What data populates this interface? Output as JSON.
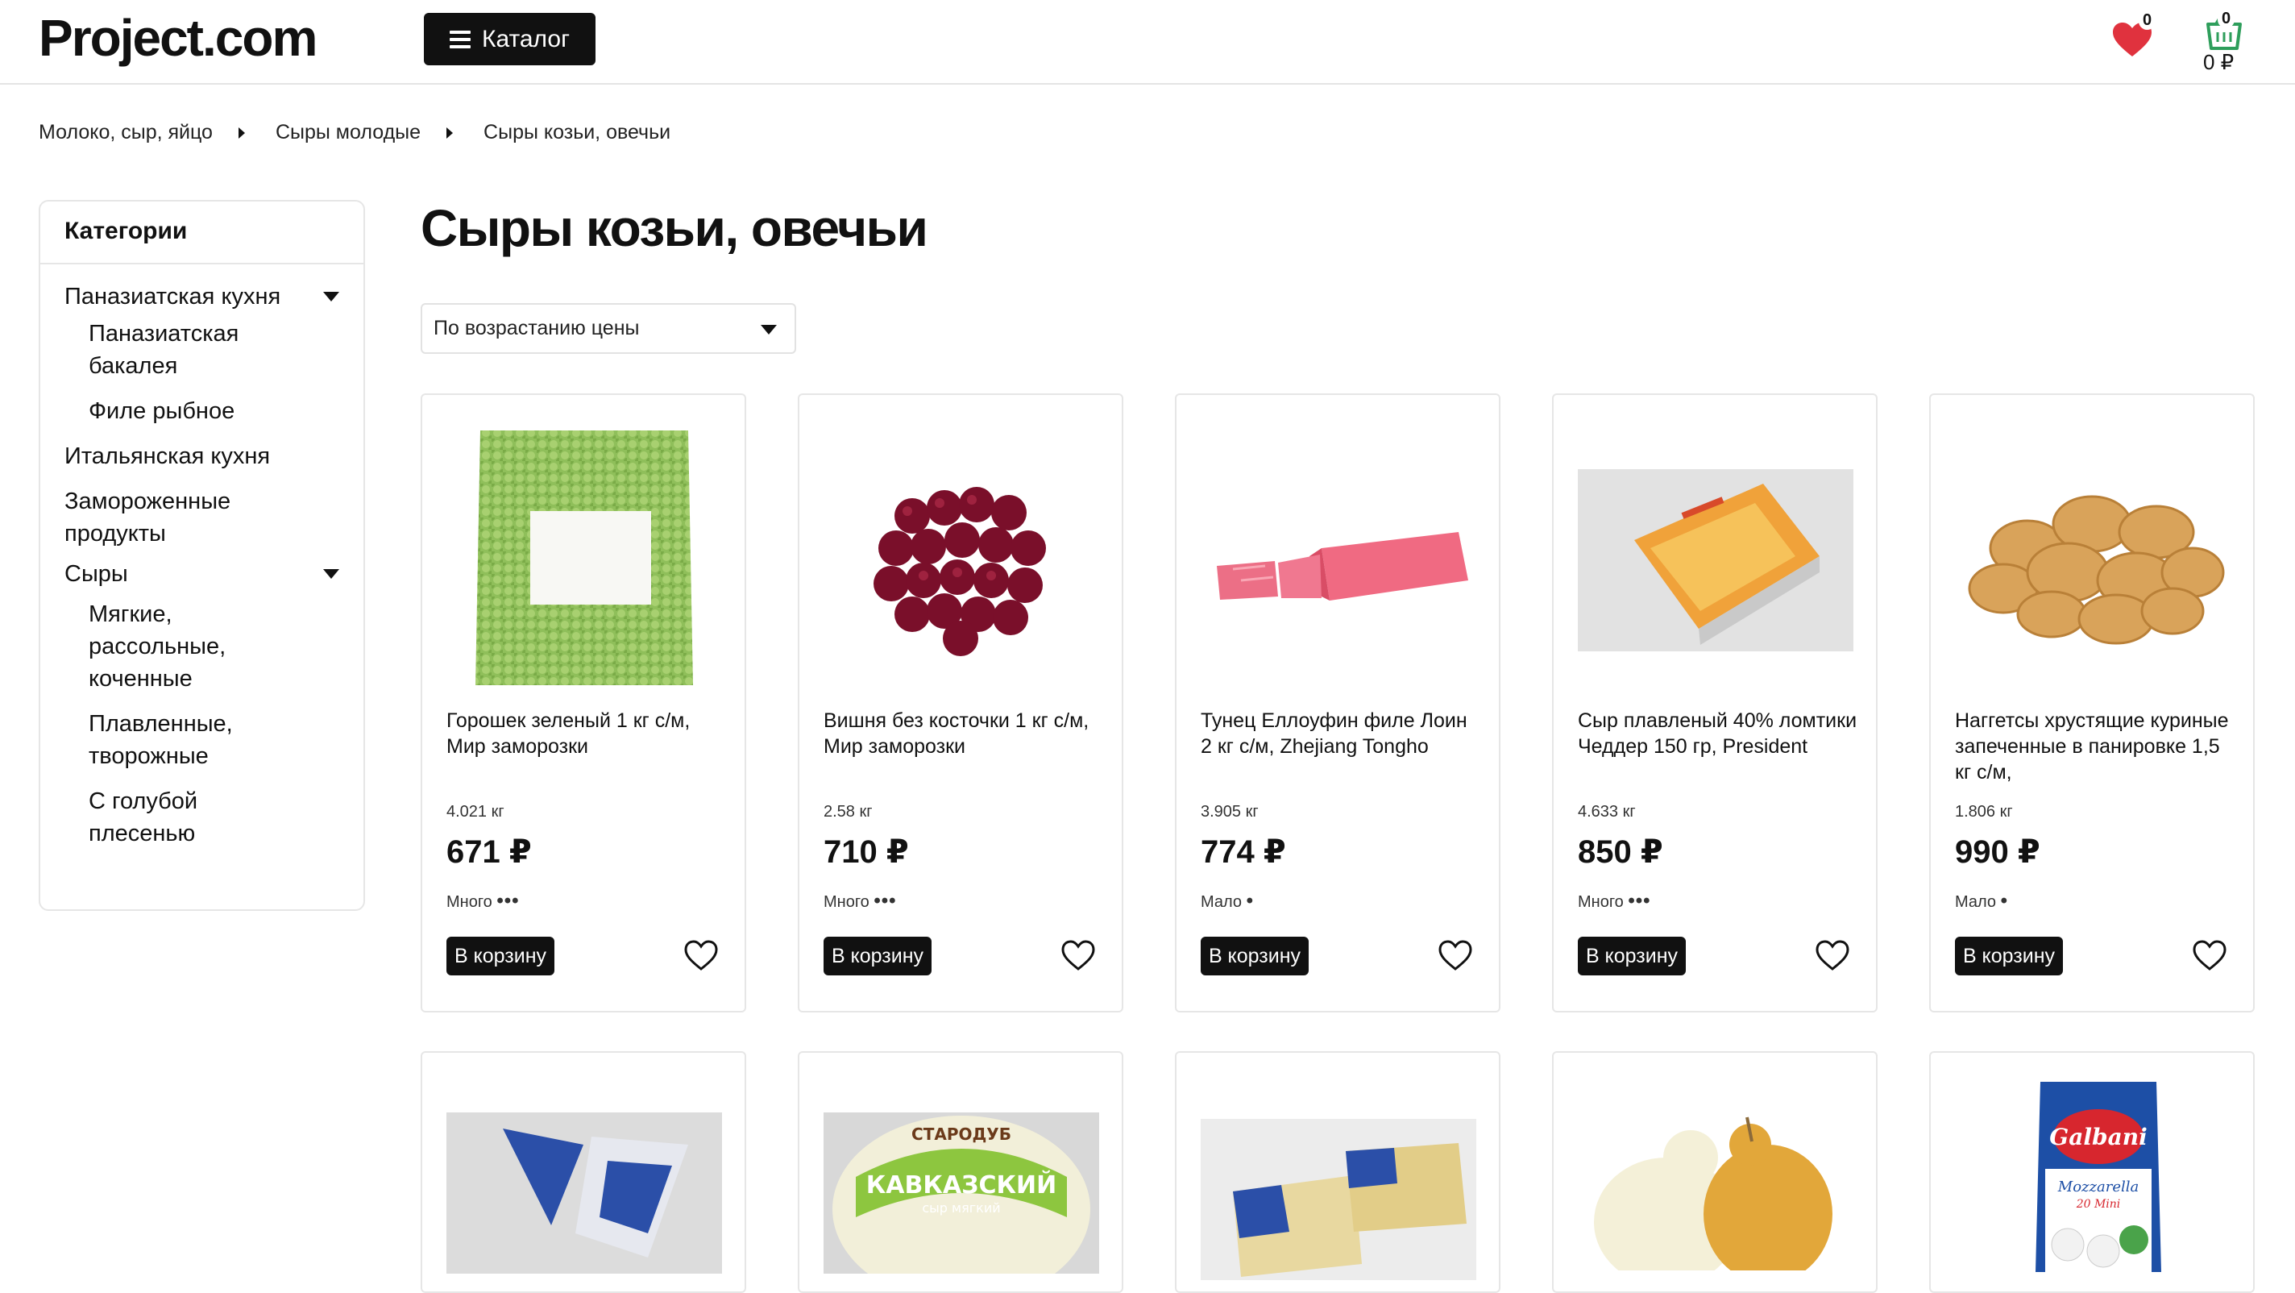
{
  "header": {
    "logo": "Project.com",
    "catalog_label": "Каталог",
    "favorites_count": "0",
    "cart_count": "0",
    "cart_sum": "0 ₽"
  },
  "breadcrumbs": [
    "Молоко, сыр, яйцо",
    "Сыры молодые",
    "Сыры козьи, овечьи"
  ],
  "sidebar": {
    "title": "Категории",
    "items": [
      {
        "label": "Паназиатская кухня",
        "level": 1,
        "expanded": true
      },
      {
        "label": "Паназиатская бакалея",
        "level": 2
      },
      {
        "label": "Филе рыбное",
        "level": 2
      },
      {
        "label": "Итальянская кухня",
        "level": 1
      },
      {
        "label": "Замороженные продукты",
        "level": 1
      },
      {
        "label": "Сыры",
        "level": 1,
        "expanded": true
      },
      {
        "label": "Мягкие, рассольные, коченные",
        "level": 2
      },
      {
        "label": "Плавленные, творожные",
        "level": 2
      },
      {
        "label": "С голубой плесенью",
        "level": 2
      }
    ]
  },
  "main": {
    "title": "Сыры козьи, овечьи",
    "sort_selected": "По возрастанию цены"
  },
  "products": [
    {
      "name": "Горошек зеленый 1 кг с/м, Мир заморозки",
      "weight": "4.021 кг",
      "price": "671 ₽",
      "stock": "Много",
      "stock_dots": "•••",
      "buy": "В корзину"
    },
    {
      "name": "Вишня без косточки 1 кг с/м, Мир заморозки",
      "weight": "2.58 кг",
      "price": "710 ₽",
      "stock": "Много",
      "stock_dots": "•••",
      "buy": "В корзину"
    },
    {
      "name": "Тунец Еллоуфин филе Лоин 2 кг с/м, Zhejiang Tongho",
      "weight": "3.905 кг",
      "price": "774 ₽",
      "stock": "Мало",
      "stock_dots": "•",
      "buy": "В корзину"
    },
    {
      "name": "Сыр плавленый 40% ломтики Чеддер 150 гр, President",
      "weight": "4.633 кг",
      "price": "850 ₽",
      "stock": "Много",
      "stock_dots": "•••",
      "buy": "В корзину"
    },
    {
      "name": "Наггетсы хрустящие куриные запеченные в панировке 1,5 кг с/м,",
      "weight": "1.806 кг",
      "price": "990 ₽",
      "stock": "Мало",
      "stock_dots": "•",
      "buy": "В корзину"
    }
  ],
  "product_images_row2": {
    "cheese_1_label": "",
    "cheese_2_label": "КАВКАЗСКИЙ",
    "cheese_2_brand": "СТАРОДУБ",
    "cheese_2_sub": "сыр мягкий",
    "cheese_5_brand": "Galbani",
    "cheese_5_product": "Mozzarella",
    "cheese_5_variant": "20 Mini"
  },
  "colors": {
    "accent": "#111111",
    "heart_red": "#e0323e",
    "cart_green": "#2e9e5b",
    "border": "#e6e6e6"
  }
}
